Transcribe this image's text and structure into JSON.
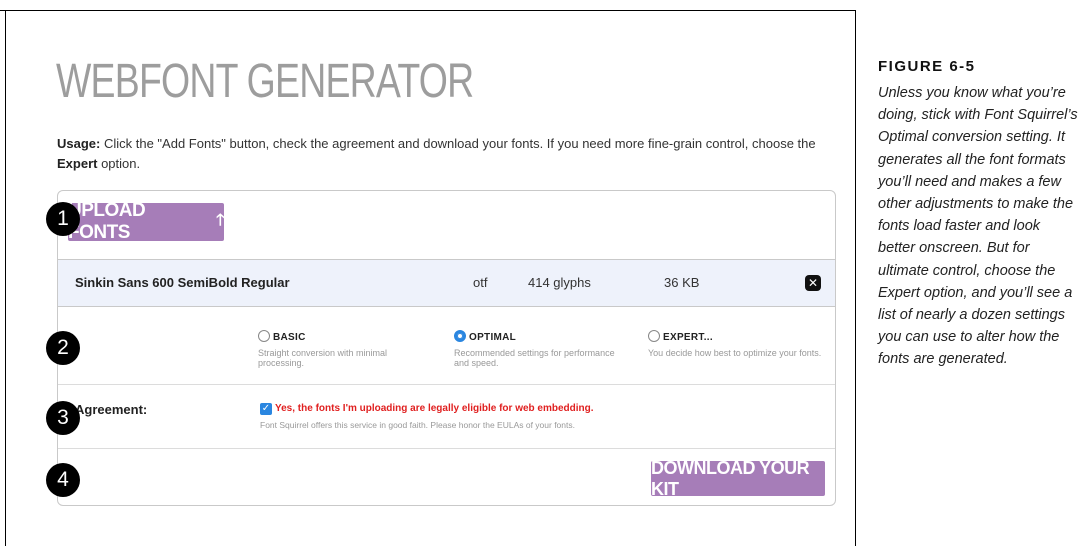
{
  "page": {
    "title": "WEBFONT GENERATOR",
    "usage_label": "Usage:",
    "usage_text_1": " Click the \"Add Fonts\" button, check the agreement and download your fonts. If you need more fine-grain control, choose the ",
    "usage_expert": "Expert",
    "usage_text_2": " option."
  },
  "upload": {
    "label": "UPLOAD FONTS",
    "icon": "arrow-up-icon"
  },
  "file": {
    "name": "Sinkin Sans 600 SemiBold Regular",
    "format": "otf",
    "glyphs": "414 glyphs",
    "size": "36 KB",
    "remove_icon": "close-icon"
  },
  "options": [
    {
      "label": "BASIC",
      "desc": "Straight conversion with minimal processing.",
      "selected": false
    },
    {
      "label": "OPTIMAL",
      "desc": "Recommended settings for performance and speed.",
      "selected": true
    },
    {
      "label": "EXPERT...",
      "desc": "You decide how best to optimize your fonts.",
      "selected": false
    }
  ],
  "agreement": {
    "label": "Agreement:",
    "checked": true,
    "text": "Yes, the fonts I'm uploading are legally eligible for web embedding.",
    "note": "Font Squirrel offers this service in good faith. Please honor the EULAs of your fonts."
  },
  "download": {
    "label": "DOWNLOAD YOUR KIT"
  },
  "steps": [
    "1",
    "2",
    "3",
    "4"
  ],
  "figure": {
    "title": "FIGURE 6-5",
    "caption": "Unless you know what you’re doing, stick with Font Squirrel’s Optimal conversion setting. It generates all the font formats you’ll need and makes a few other adjustments to make the fonts load faster and look better onscreen. But for ultimate control, choose the Expert option, and you’ll see a list of nearly a dozen settings you can use to alter how the fonts are generated."
  },
  "colors": {
    "accent": "#a67db8",
    "radio_blue": "#2a86e0",
    "warning_red": "#e02020",
    "file_row_bg": "#eef2fb"
  }
}
